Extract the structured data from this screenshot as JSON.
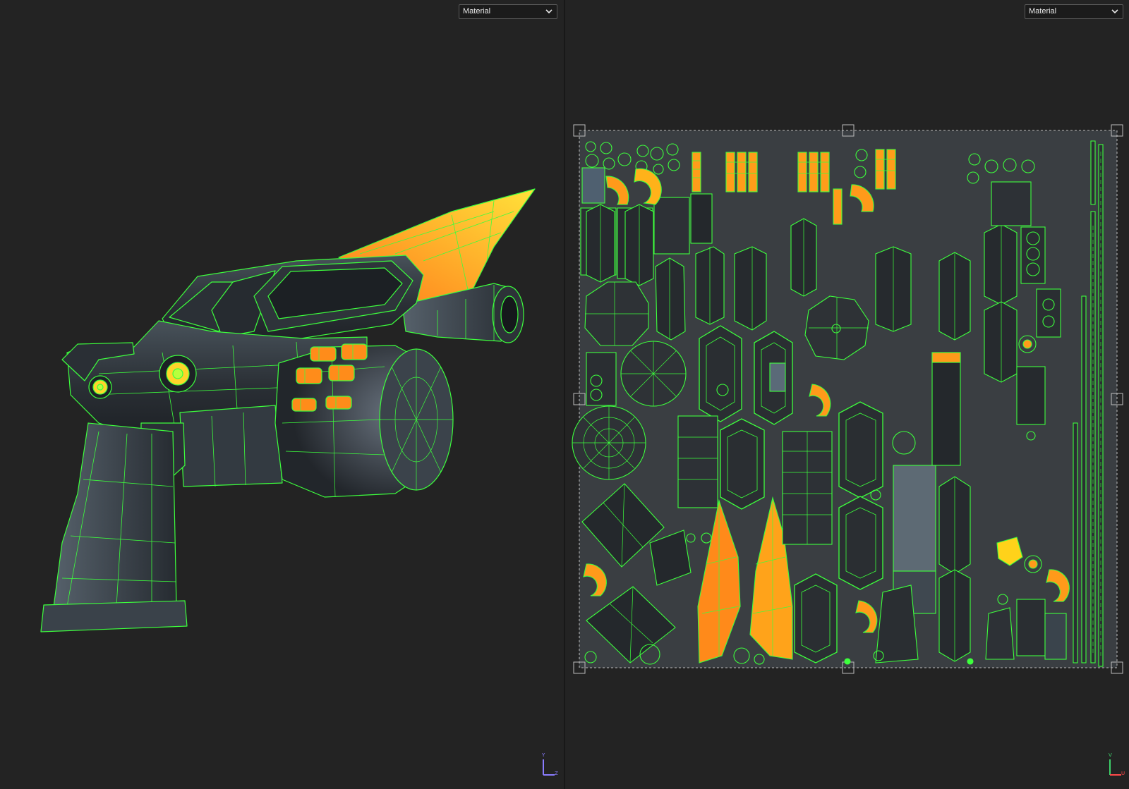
{
  "viewport_3d": {
    "shading_dropdown": {
      "selected": "Material"
    },
    "axis": {
      "vertical": "Y",
      "horizontal": "Z"
    }
  },
  "viewport_uv": {
    "shading_dropdown": {
      "selected": "Material"
    },
    "axis": {
      "vertical": "V",
      "horizontal": "U"
    }
  },
  "colors": {
    "background": "#232323",
    "wireframe": "#3dff3d",
    "accent_orange": "#ff8c1a",
    "accent_yellow": "#ffe23a",
    "mesh_dark": "#2f3338"
  },
  "icons": {
    "dropdown": "chevron-down-icon",
    "axis_gizmo": "axis-gizmo-icon",
    "selection_handle": "selection-handle-icon"
  }
}
